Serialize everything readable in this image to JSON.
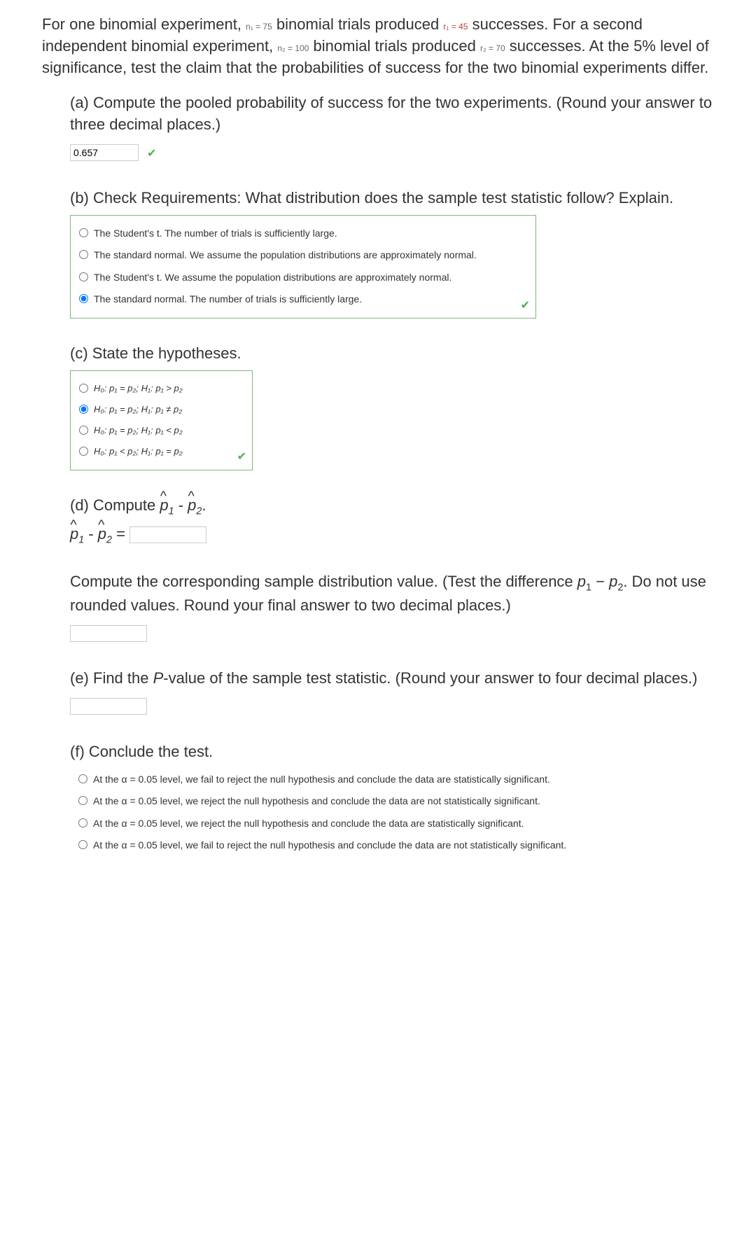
{
  "intro": {
    "seg1": "For one binomial experiment, ",
    "n1": "n₁ = 75",
    "seg2": " binomial trials produced ",
    "r1": "r₁ = 45",
    "seg3": " successes. For a second independent binomial experiment, ",
    "n2": "n₂ = 100",
    "seg4": " binomial trials produced ",
    "r2": "r₂ = 70",
    "seg5": " successes. At the 5% level of significance, test the claim that the probabilities of success for the two binomial experiments differ."
  },
  "partA": {
    "text": "(a) Compute the pooled probability of success for the two experiments. (Round your answer to three decimal places.)",
    "value": "0.657"
  },
  "partB": {
    "text": "(b) Check Requirements: What distribution does the sample test statistic follow? Explain.",
    "options": [
      "The Student's t. The number of trials is sufficiently large.",
      "The standard normal. We assume the population distributions are approximately normal.",
      "The Student's t. We assume the population distributions are approximately normal.",
      "The standard normal. The number of trials is sufficiently large."
    ],
    "selected": 3
  },
  "partC": {
    "text": "(c) State the hypotheses.",
    "options": [
      "H₀: p₁ = p₂; H₁: p₁ > p₂",
      "H₀: p₁ = p₂; H₁: p₁ ≠ p₂",
      "H₀: p₁ = p₂; H₁: p₁ < p₂",
      "H₀: p₁ < p₂; H₁: p₁ = p₂"
    ],
    "selected": 1
  },
  "partD": {
    "line1_pre": "(d) Compute ",
    "line2_eq": " = ",
    "phat_diff_label": "p̂₁ - p̂₂",
    "text2": "Compute the corresponding sample distribution value. (Test the difference p₁ − p₂. Do not use rounded values. Round your final answer to two decimal places.)"
  },
  "partE": {
    "text": "(e) Find the P-value of the sample test statistic. (Round your answer to four decimal places.)"
  },
  "partF": {
    "text": "(f) Conclude the test.",
    "options": [
      "At the α = 0.05 level, we fail to reject the null hypothesis and conclude the data are statistically significant.",
      "At the α = 0.05 level, we reject the null hypothesis and conclude the data are not statistically significant.",
      "At the α = 0.05 level, we reject the null hypothesis and conclude the data are statistically significant.",
      "At the α = 0.05 level, we fail to reject the null hypothesis and conclude the data are not statistically significant."
    ]
  }
}
